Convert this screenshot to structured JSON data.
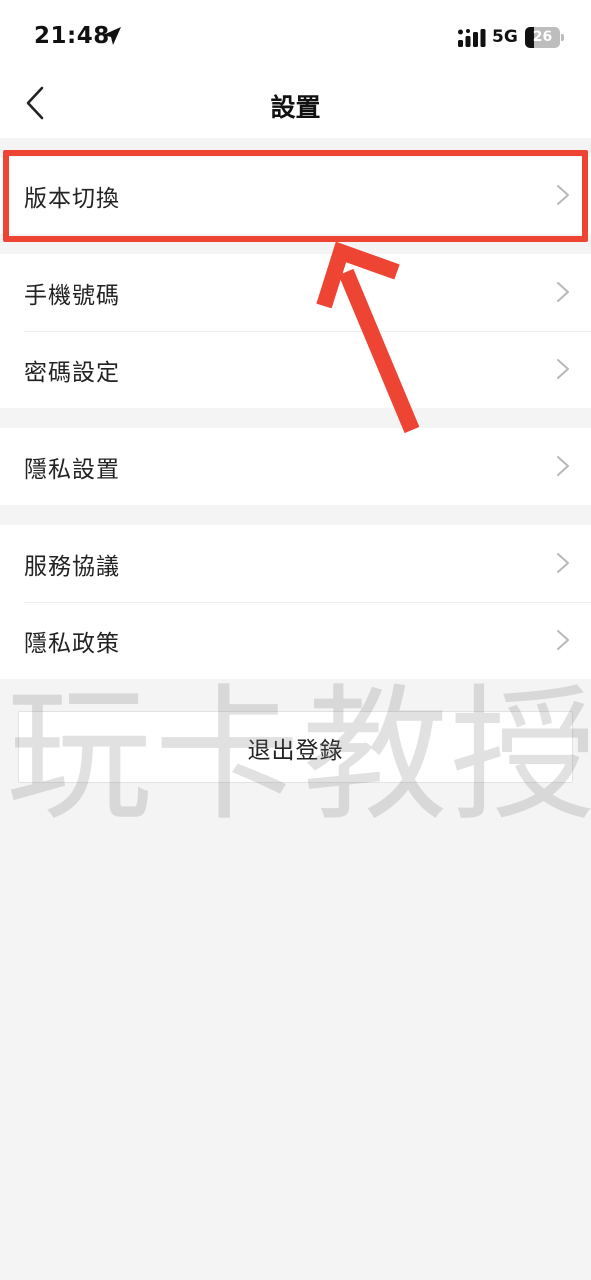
{
  "status_bar": {
    "time": "21:48",
    "network": "5G",
    "battery_level": "26"
  },
  "nav": {
    "title": "設置"
  },
  "groups": [
    {
      "items": [
        {
          "label": "版本切換"
        }
      ]
    },
    {
      "items": [
        {
          "label": "手機號碼"
        },
        {
          "label": "密碼設定"
        }
      ]
    },
    {
      "items": [
        {
          "label": "隱私設置"
        }
      ]
    },
    {
      "items": [
        {
          "label": "服務協議"
        },
        {
          "label": "隱私政策"
        }
      ]
    }
  ],
  "logout": {
    "label": "退出登錄"
  },
  "watermark": {
    "text": "玩卡教授"
  },
  "colors": {
    "highlight": "#ee4433",
    "background": "#f4f4f4",
    "row_background": "#ffffff"
  },
  "icons": {
    "back": "chevron-left-icon",
    "row_arrow": "chevron-right-icon",
    "location": "location-arrow-icon",
    "signal": "signal-icon",
    "battery": "battery-icon"
  }
}
